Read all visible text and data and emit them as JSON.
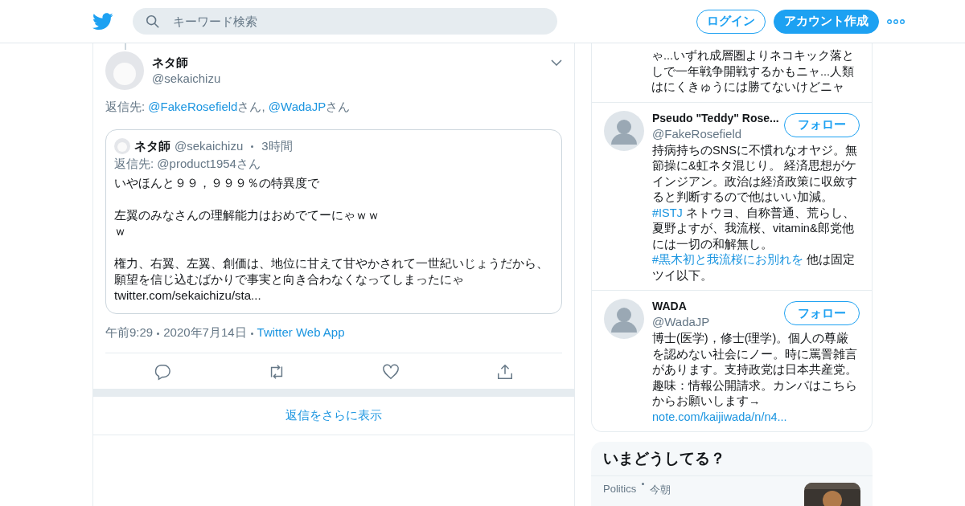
{
  "header": {
    "search": {
      "placeholder": "キーワード検索"
    },
    "buttons": [
      {
        "label": "ログイン",
        "kind": "outline"
      },
      {
        "label": "アカウント作成",
        "kind": "filled"
      }
    ]
  },
  "tweet": {
    "name": "ネタ師",
    "handle": "@sekaichizu",
    "reply_to": [
      {
        "kind": "text",
        "text": "返信先: "
      },
      {
        "kind": "link",
        "text": "@FakeRosefield"
      },
      {
        "kind": "text",
        "text": "さん, "
      },
      {
        "kind": "link",
        "text": "@WadaJP"
      },
      {
        "kind": "text",
        "text": "さん"
      }
    ],
    "quote": {
      "name": "ネタ師",
      "handle": "@sekaichizu",
      "time": "3時間",
      "reply_to": "返信先: @product1954さん",
      "paragraphs": [
        [
          "いやほんと９９，９９９％の特異度で"
        ],
        [
          "左翼のみなさんの理解能力はおめでてーにゃｗｗ",
          "ｗ"
        ],
        [
          "権力、右翼、左翼、創価は、地位に甘えて甘やかされて一世紀いじょうだから、願望を信じ込むばかりで事実と向き合わなくなってしまったにゃ"
        ]
      ],
      "link": "twitter.com/sekaichizu/sta..."
    },
    "time": "午前9:29",
    "date": "2020年7月14日",
    "source": "Twitter Web App"
  },
  "show_more": "返信をさらに表示",
  "users": [
    {
      "kind": "cut",
      "bio": [
        {
          "kind": "text",
          "text": "ゃ...いずれ成層圏よりネコキック落としで一年戦争開戦するかもニャ...人類はにくきゅうには勝てないけどニャ"
        }
      ]
    },
    {
      "kind": "full",
      "name": "Pseudo \"Teddy\" Rose...",
      "handle": "@FakeRosefield",
      "follow": "フォロー",
      "bio": [
        {
          "kind": "text",
          "text": "持病持ちのSNSに不慣れなオヤジ。無節操に&虹ネタ混じり。 経済思想がケインジアン。政治は経済政策に収斂すると判断するので他はいい加減。"
        },
        {
          "kind": "link",
          "text": "#ISTJ"
        },
        {
          "kind": "text",
          "text": " ネトウヨ、自称普通、荒らし、夏野よすが、我流桜、vitamin&郎党他には一切の和解無し。 "
        },
        {
          "kind": "link",
          "text": "#黒木初と我流桜にお別れを"
        },
        {
          "kind": "text",
          "text": " 他は固定ツイ以下。"
        }
      ]
    },
    {
      "kind": "full",
      "name": "WADA",
      "handle": "@WadaJP",
      "follow": "フォロー",
      "bio": [
        {
          "kind": "text",
          "text": "博士(医学)，修士(理学)。個人の尊厳を認めない社会にノー。時に罵詈雑言があります。支持政党は日本共産党。趣味：情報公開請求。カンパはこちらからお願いします→ "
        },
        {
          "kind": "link",
          "text": "note.com/kaijiwada/n/n4..."
        }
      ]
    }
  ],
  "trends": {
    "title": "いまどうしてる？",
    "items": [
      {
        "category": "Politics",
        "time": "今朝"
      }
    ]
  }
}
